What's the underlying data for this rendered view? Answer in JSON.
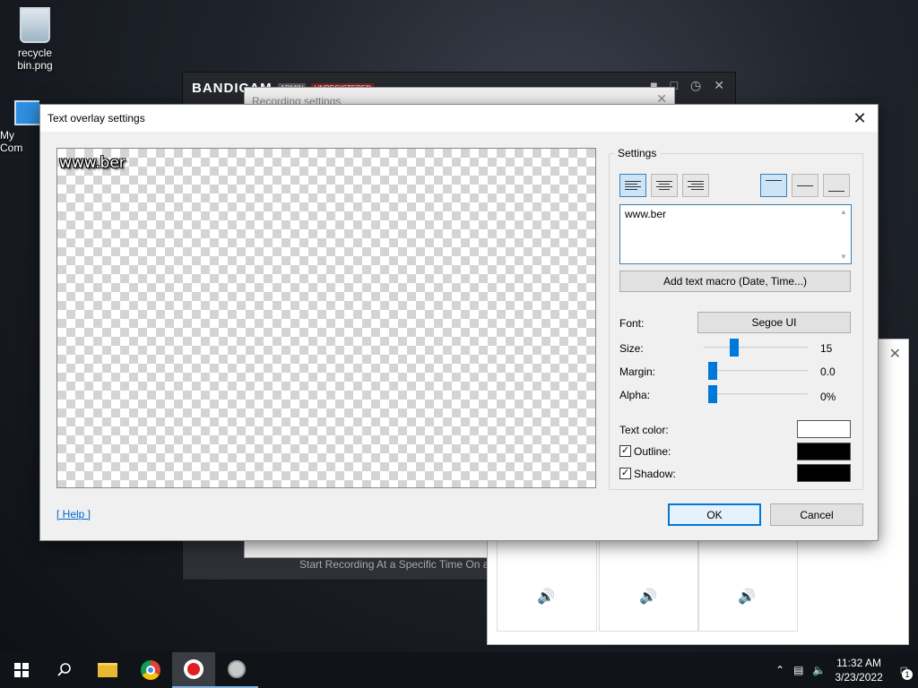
{
  "desktop": {
    "icons": [
      {
        "label": "recycle\nbin.png"
      },
      {
        "label": "My Com"
      }
    ]
  },
  "bandicam": {
    "brand": "BANDICAM",
    "tag_admin": "ADMIN",
    "tag_unregistered": "UNREGISTERED",
    "footer": "Start Recording At a Specific Time On a Daily/Weekly schedule"
  },
  "recording_settings": {
    "title": "Recording settings"
  },
  "dialog": {
    "title": "Text overlay settings",
    "preview_text": "www.ber",
    "settings_label": "Settings",
    "text_value": "www.ber",
    "macro_button": "Add text macro (Date, Time...)",
    "font_label": "Font:",
    "font_value": "Segoe UI",
    "size_label": "Size:",
    "size_value": "15",
    "size_fraction": 0.29,
    "margin_label": "Margin:",
    "margin_value": "0.0",
    "margin_fraction": 0.0,
    "alpha_label": "Alpha:",
    "alpha_value": "0%",
    "alpha_fraction": 0.0,
    "text_color_label": "Text color:",
    "text_color": "#ffffff",
    "outline_label": "Outline:",
    "outline_checked": true,
    "outline_color": "#000000",
    "shadow_label": "Shadow:",
    "shadow_checked": true,
    "shadow_color": "#000000",
    "help_link": "[ Help ]",
    "ok_label": "OK",
    "cancel_label": "Cancel",
    "horizontal_align_selected": "left",
    "vertical_align_selected": "top"
  },
  "taskbar": {
    "time": "11:32 AM",
    "date": "3/23/2022",
    "notification_count": "1"
  }
}
